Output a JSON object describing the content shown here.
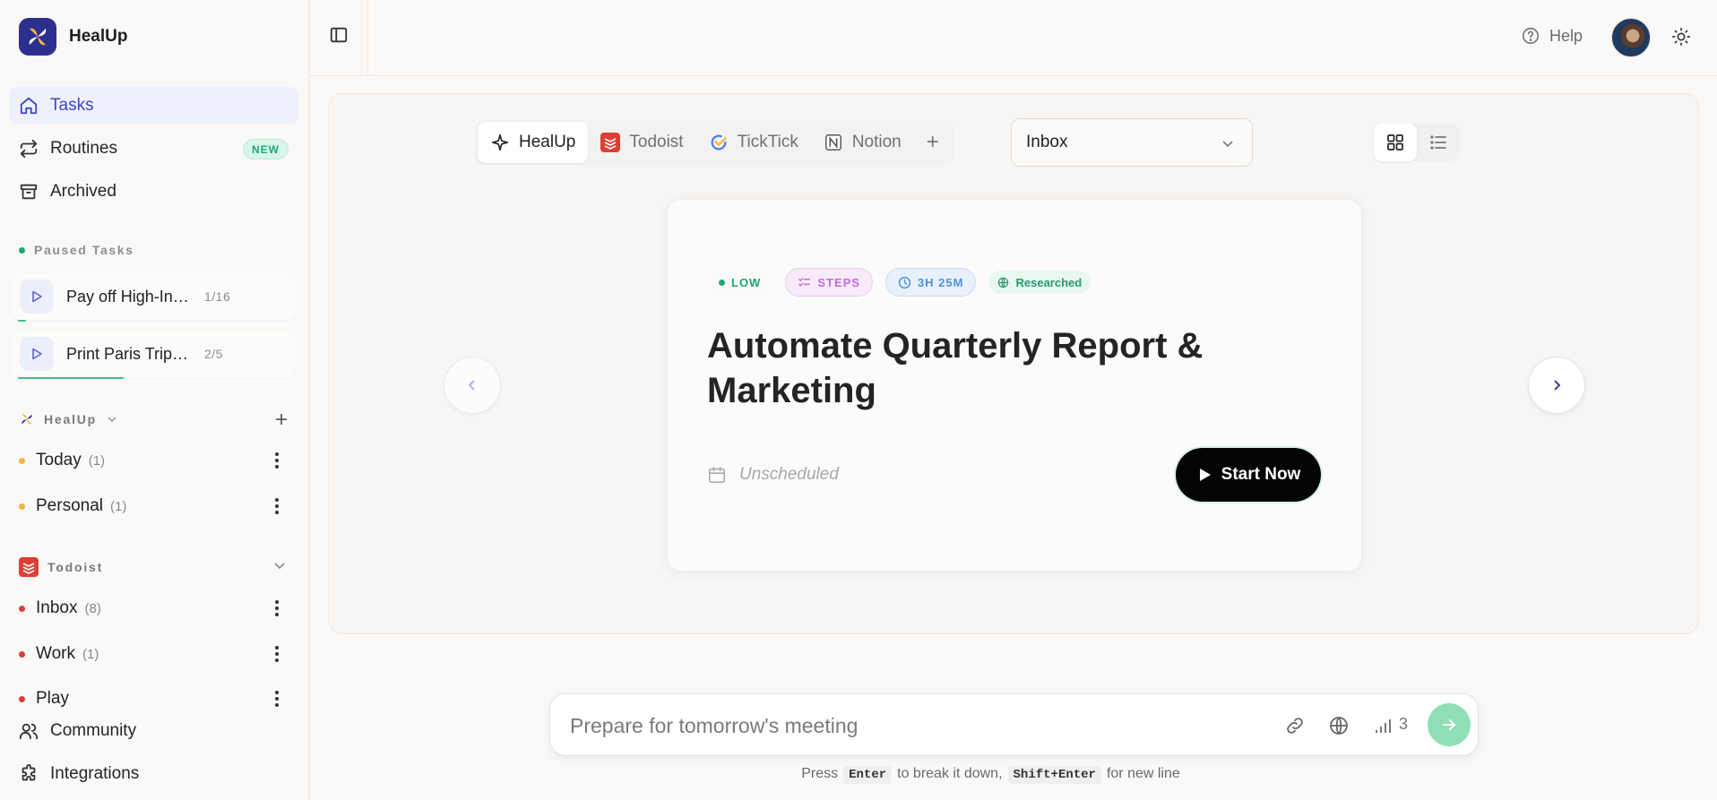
{
  "app": {
    "name": "HealUp"
  },
  "sidebar": {
    "nav": [
      {
        "label": "Tasks",
        "icon": "home-icon",
        "active": true
      },
      {
        "label": "Routines",
        "icon": "repeat-icon",
        "badge": "NEW"
      },
      {
        "label": "Archived",
        "icon": "archive-icon"
      }
    ],
    "paused": {
      "label": "Paused Tasks",
      "items": [
        {
          "title": "Pay off High-Interest Debt",
          "count": "1/16"
        },
        {
          "title": "Print Paris Trip Docs",
          "count": "2/5"
        }
      ]
    },
    "groups": {
      "healup": {
        "name": "HealUp",
        "items": [
          {
            "name": "Today",
            "count": "(1)"
          },
          {
            "name": "Personal",
            "count": "(1)"
          }
        ]
      },
      "todoist": {
        "name": "Todoist",
        "items": [
          {
            "name": "Inbox",
            "count": "(8)"
          },
          {
            "name": "Work",
            "count": "(1)"
          },
          {
            "name": "Play",
            "count": ""
          }
        ]
      }
    },
    "bottom": {
      "community": "Community",
      "integrations": "Integrations"
    }
  },
  "header": {
    "help": "Help"
  },
  "main": {
    "tabs": [
      {
        "label": "HealUp",
        "active": true
      },
      {
        "label": "Todoist"
      },
      {
        "label": "TickTick"
      },
      {
        "label": "Notion"
      }
    ],
    "project_select": {
      "value": "Inbox"
    },
    "card": {
      "chips": {
        "priority": "LOW",
        "steps": "STEPS",
        "time": "3H 25M",
        "researched": "Researched"
      },
      "title": "Automate Quarterly Report & Marketing",
      "schedule": "Unscheduled",
      "start": "Start Now"
    }
  },
  "composer": {
    "placeholder": "Prepare for tomorrow's meeting",
    "depth": "3",
    "hint": {
      "press": "Press",
      "key1": "Enter",
      "mid": "to break it down,",
      "key2": "Shift+Enter",
      "end": "for new line"
    }
  },
  "colors": {
    "accent": "#3c47c6",
    "success": "#1ea870",
    "todoist": "#db4035",
    "healup_dot": "#f4b63f"
  }
}
